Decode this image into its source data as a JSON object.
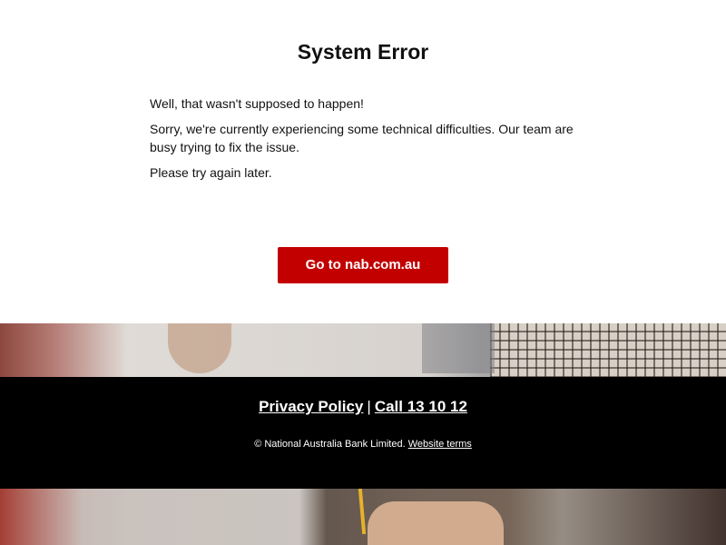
{
  "error": {
    "title": "System Error",
    "paragraphs": [
      "Well, that wasn't supposed to happen!",
      "Sorry, we're currently experiencing some technical difficulties. Our team are busy trying to fix the issue.",
      "Please try again later."
    ],
    "button_label": "Go to nab.com.au"
  },
  "footer": {
    "privacy_label": "Privacy Policy",
    "separator": "|",
    "call_label": "Call 13 10 12",
    "copyright_text": "© National Australia Bank Limited.",
    "website_terms_label": "Website terms"
  },
  "colors": {
    "brand_red": "#c20000",
    "footer_bg": "#000000"
  }
}
